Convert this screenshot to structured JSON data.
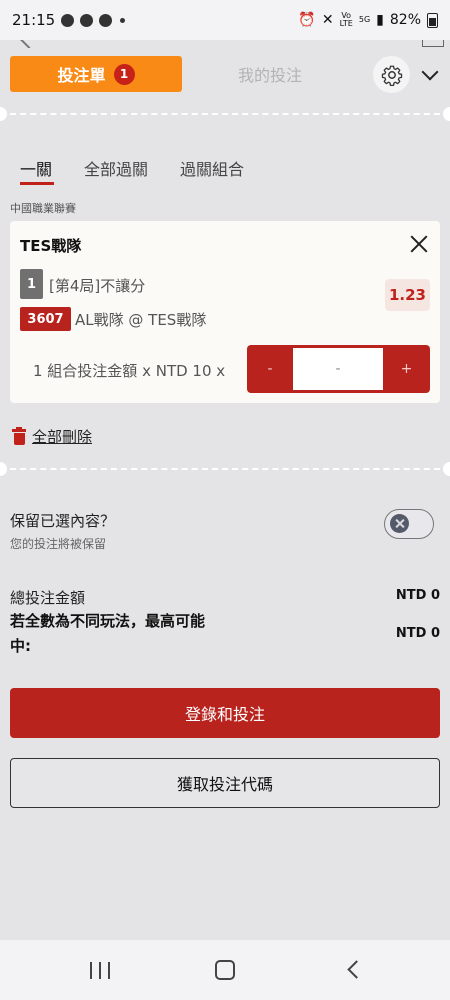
{
  "status_bar": {
    "time": "21:15",
    "network": "5G",
    "battery": "82%"
  },
  "header": {
    "betslip_tab": "投注單",
    "betslip_count": "1",
    "mybets_tab": "我的投注"
  },
  "subtabs": [
    {
      "label": "一關",
      "active": true
    },
    {
      "label": "全部過關",
      "active": false
    },
    {
      "label": "過關組合",
      "active": false
    }
  ],
  "league": "中國職業聯賽",
  "bet": {
    "selection": "TES戰隊",
    "market_number": "1",
    "market": "[第4局]不讓分",
    "odds": "1.23",
    "match_id": "3607",
    "match": "AL戰隊 @ TES戰隊",
    "combo_text": "1 組合投注金額 x NTD 10 x",
    "stepper": {
      "minus": "-",
      "value": "-",
      "plus": "+"
    }
  },
  "delete_all": "全部刪除",
  "keep_selection": {
    "title": "保留已選內容？",
    "subtitle": "您的投注將被保留",
    "enabled": false
  },
  "totals": {
    "total_label": "總投注金額",
    "total_value": "NTD 0",
    "max_label": "若全數為不同玩法，最高可能中:",
    "max_value": "NTD 0"
  },
  "buttons": {
    "login_bet": "登錄和投注",
    "get_code": "獲取投注代碼"
  },
  "colors": {
    "accent_orange": "#f98a15",
    "brand_red": "#b8231e",
    "odds_bg": "#f6e6e1"
  }
}
